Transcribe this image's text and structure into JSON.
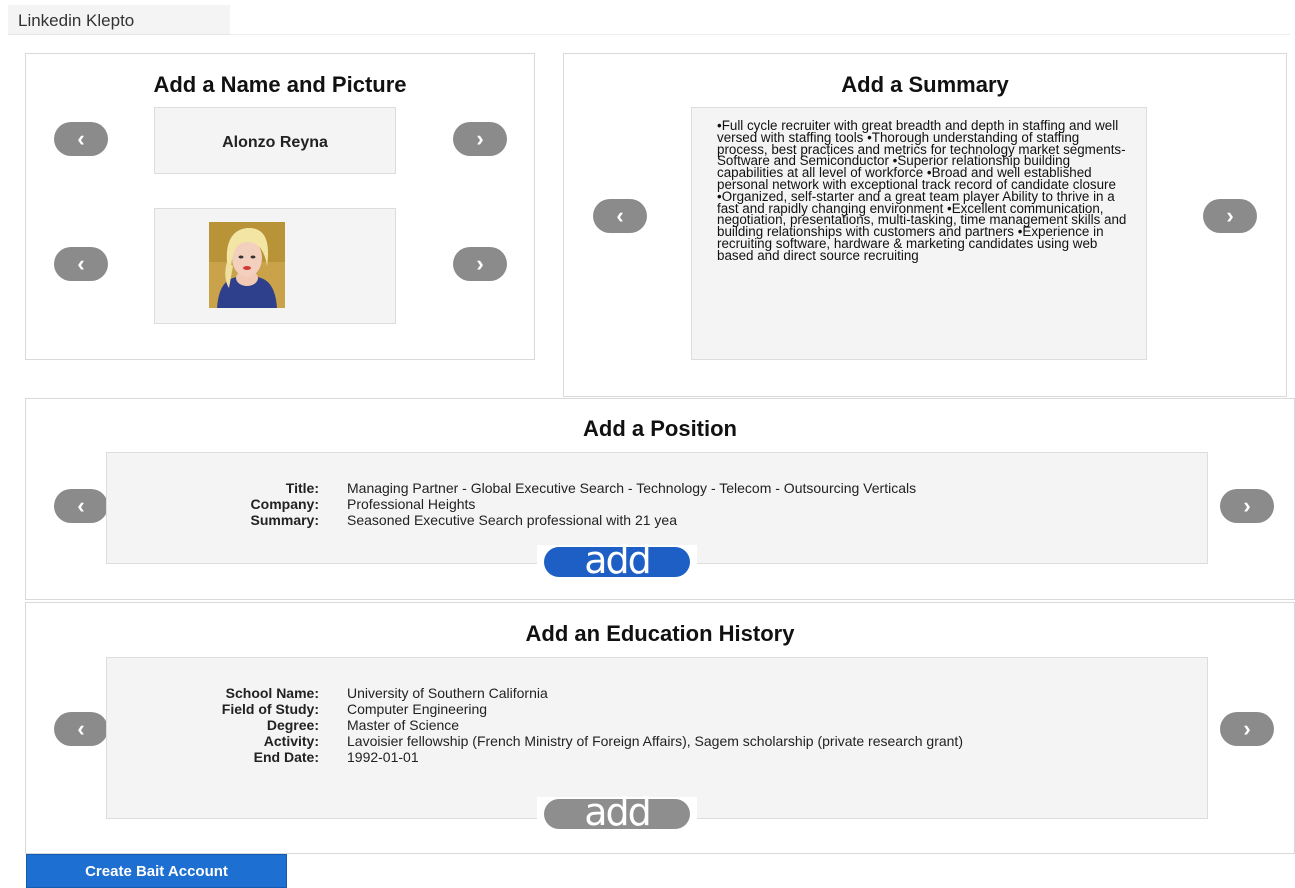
{
  "app": {
    "tab_title": "Linkedin Klepto"
  },
  "name_panel": {
    "title": "Add a Name and Picture",
    "name": "Alonzo Reyna",
    "prev_label": "‹",
    "next_label": "›"
  },
  "summary_panel": {
    "title": "Add a Summary",
    "text": "•Full cycle recruiter with great breadth and depth in staffing and well versed with staffing tools •Thorough understanding of staffing process, best practices and metrics for technology market segments- Software and Semiconductor •Superior relationship building capabilities at all level of workforce •Broad and well established personal network with exceptional track record of candidate closure •Organized, self-starter and a great team player Ability to thrive in a fast and rapidly changing environment •Excellent communication, negotiation, presentations, multi-tasking, time management skills and building relationships with customers and partners •Experience in recruiting software, hardware & marketing candidates using web based and direct source recruiting"
  },
  "position_panel": {
    "title": "Add a Position",
    "rows": [
      {
        "label": "Title:",
        "value": "Managing Partner - Global Executive Search - Technology - Telecom - Outsourcing Verticals"
      },
      {
        "label": "Company:",
        "value": "Professional Heights"
      },
      {
        "label": "Summary:",
        "value": "Seasoned Executive Search professional with 21 yea"
      }
    ],
    "add_label": "add",
    "add_color": "#1d5fc4"
  },
  "education_panel": {
    "title": "Add an Education History",
    "rows": [
      {
        "label": "School Name:",
        "value": "University of Southern California"
      },
      {
        "label": "Field of Study:",
        "value": "Computer Engineering"
      },
      {
        "label": "Degree:",
        "value": "Master of Science"
      },
      {
        "label": "Activity:",
        "value": "Lavoisier fellowship (French Ministry of Foreign Affairs), Sagem scholarship (private research grant)"
      },
      {
        "label": "End Date:",
        "value": "1992-01-01"
      }
    ],
    "add_label": "add",
    "add_color": "#8e8e8e"
  },
  "footer": {
    "create_label": "Create Bait Account"
  }
}
